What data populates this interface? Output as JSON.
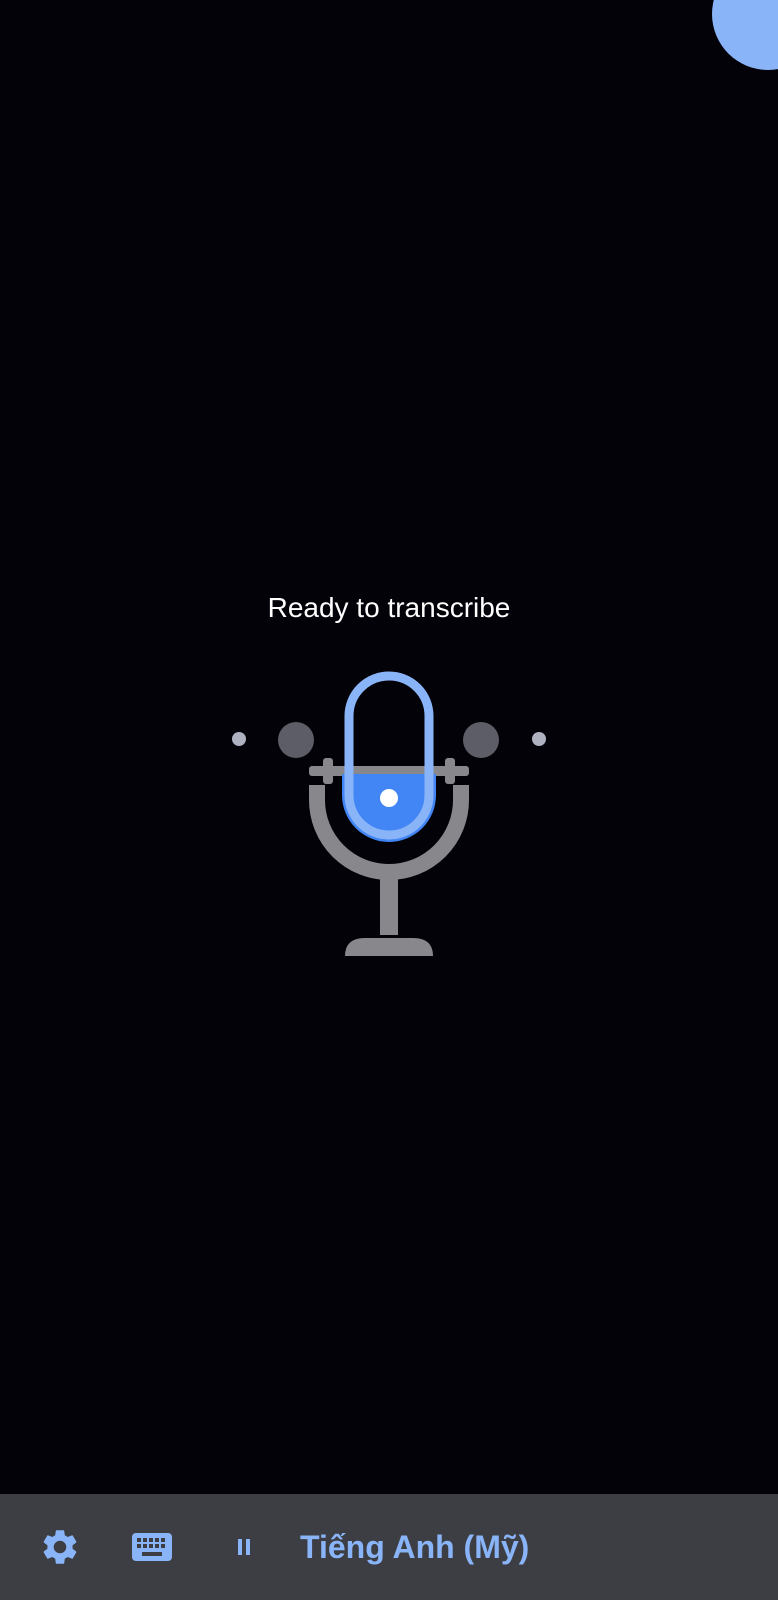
{
  "transcribe": {
    "status_text": "Ready to transcribe"
  },
  "toolbar": {
    "language_label": "Tiếng Anh (Mỹ)"
  },
  "icons": {
    "settings": "gear-icon",
    "keyboard": "keyboard-icon",
    "pause": "pause-icon",
    "microphone": "microphone-icon"
  },
  "colors": {
    "background": "#030208",
    "accent": "#8ab4f8",
    "mic_fill": "#4285f4",
    "bottom_bar": "#3d3e44",
    "mic_stand": "#87878c"
  }
}
